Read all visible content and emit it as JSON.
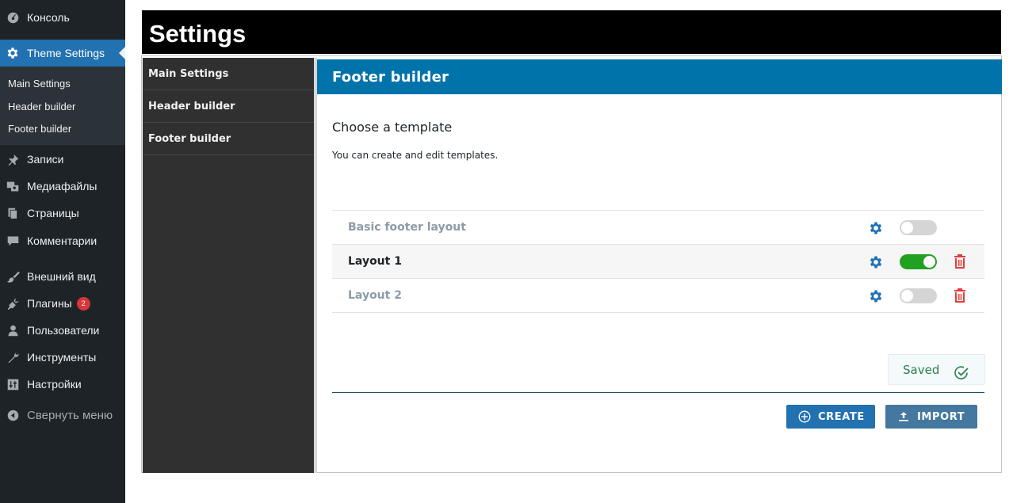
{
  "sidebar": {
    "items": [
      {
        "label": "Консоль",
        "icon": "dashboard-icon"
      },
      {
        "label": "Theme Settings",
        "icon": "gear-icon"
      },
      {
        "label": "Записи",
        "icon": "pin-icon"
      },
      {
        "label": "Медиафайлы",
        "icon": "media-icon"
      },
      {
        "label": "Страницы",
        "icon": "pages-icon"
      },
      {
        "label": "Комментарии",
        "icon": "comment-icon"
      },
      {
        "label": "Внешний вид",
        "icon": "brush-icon"
      },
      {
        "label": "Плагины",
        "icon": "plugin-icon",
        "badge": "2"
      },
      {
        "label": "Пользователи",
        "icon": "user-icon"
      },
      {
        "label": "Инструменты",
        "icon": "wrench-icon"
      },
      {
        "label": "Настройки",
        "icon": "settings-sliders-icon"
      }
    ],
    "submenu": [
      "Main Settings",
      "Header builder",
      "Footer builder"
    ],
    "collapse_label": "Свернуть меню"
  },
  "page": {
    "title": "Settings",
    "nav": [
      "Main Settings",
      "Header builder",
      "Footer builder"
    ],
    "section_title": "Footer builder",
    "choose_title": "Choose a template",
    "description": "You can create and edit templates."
  },
  "templates": [
    {
      "name": "Basic footer layout",
      "enabled": false,
      "deletable": false
    },
    {
      "name": "Layout 1",
      "enabled": true,
      "deletable": true
    },
    {
      "name": "Layout 2",
      "enabled": false,
      "deletable": true
    }
  ],
  "status": {
    "saved_label": "Saved"
  },
  "actions": {
    "create_label": "CREATE",
    "import_label": "IMPORT"
  },
  "colors": {
    "accent": "#2271b1",
    "header": "#0073aa",
    "toggle_on": "#22a020",
    "delete": "#e53b3b"
  }
}
